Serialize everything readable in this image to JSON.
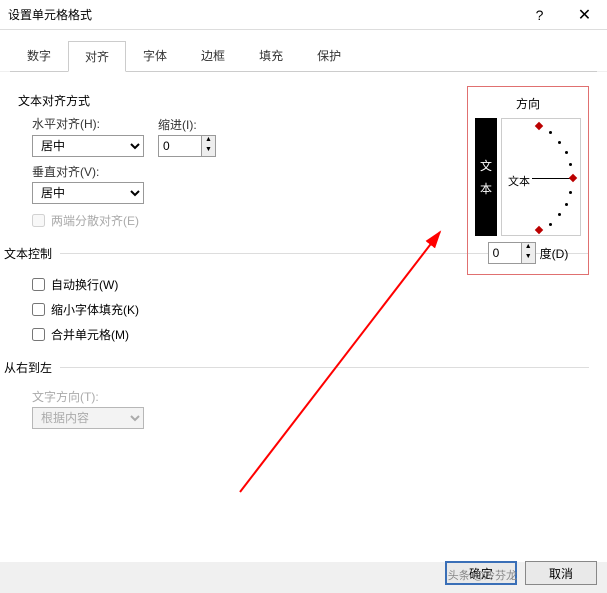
{
  "window": {
    "title": "设置单元格格式",
    "help": "?",
    "close": "✕"
  },
  "tabs": [
    "数字",
    "对齐",
    "字体",
    "边框",
    "填充",
    "保护"
  ],
  "active_tab": 1,
  "align": {
    "section": "文本对齐方式",
    "h_label": "水平对齐(H):",
    "h_value": "居中",
    "indent_label": "缩进(I):",
    "indent_value": "0",
    "v_label": "垂直对齐(V):",
    "v_value": "居中",
    "justify_label": "两端分散对齐(E)"
  },
  "textctrl": {
    "section": "文本控制",
    "wrap": "自动换行(W)",
    "shrink": "缩小字体填充(K)",
    "merge": "合并单元格(M)"
  },
  "rtl": {
    "section": "从右到左",
    "dir_label": "文字方向(T):",
    "dir_value": "根据内容"
  },
  "direction": {
    "label": "方向",
    "vtext1": "文",
    "vtext2": "本",
    "arc_word": "文本",
    "deg_value": "0",
    "deg_label": "度(D)"
  },
  "footer": {
    "ok": "确定",
    "cancel": "取消"
  },
  "watermark": "头条 @冷芬龙"
}
